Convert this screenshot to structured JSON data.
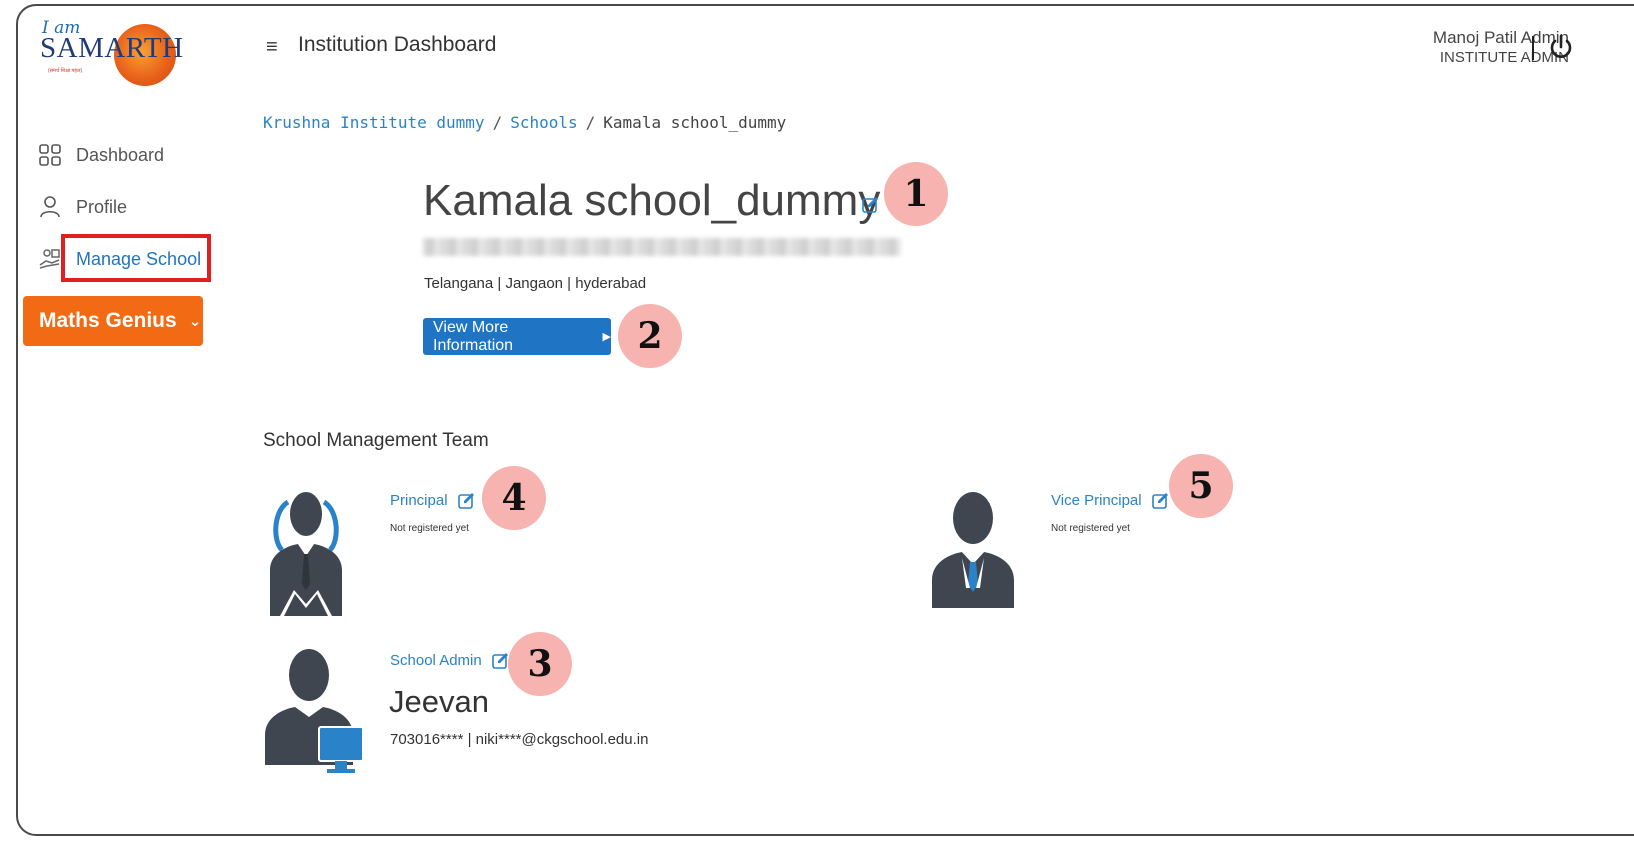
{
  "logo": {
    "iam": "I am",
    "word": "SAMARTH",
    "tagline": "(समर्थ शिक्षा पहल)"
  },
  "header": {
    "title": "Institution Dashboard",
    "user_name": "Manoj Patil Admin",
    "user_role": "INSTITUTE ADMIN"
  },
  "sidebar": {
    "items": [
      {
        "label": "Dashboard",
        "icon": "grid-icon"
      },
      {
        "label": "Profile",
        "icon": "user-icon"
      },
      {
        "label": "Manage School",
        "icon": "school-hand-icon",
        "active": true
      }
    ],
    "dropdown_label": "Maths Genius"
  },
  "breadcrumb": {
    "items": [
      "Krushna Institute dummy",
      "Schools",
      "Kamala school_dummy"
    ]
  },
  "school": {
    "name": "Kamala school_dummy",
    "location": "Telangana | Jangaon | hyderabad",
    "view_more_label": "View More Information"
  },
  "team": {
    "heading": "School Management Team",
    "principal": {
      "role": "Principal",
      "status": "Not registered yet"
    },
    "vice_principal": {
      "role": "Vice Principal",
      "status": "Not registered yet"
    },
    "school_admin": {
      "role": "School Admin",
      "name": "Jeevan",
      "contact": "703016**** | niki****@ckgschool.edu.in"
    }
  },
  "markers": [
    "1",
    "2",
    "3",
    "4",
    "5"
  ],
  "colors": {
    "accent": "#1f74c4",
    "orange": "#f26a13",
    "highlight": "#e0201f",
    "marker": "#f6b3b0"
  }
}
